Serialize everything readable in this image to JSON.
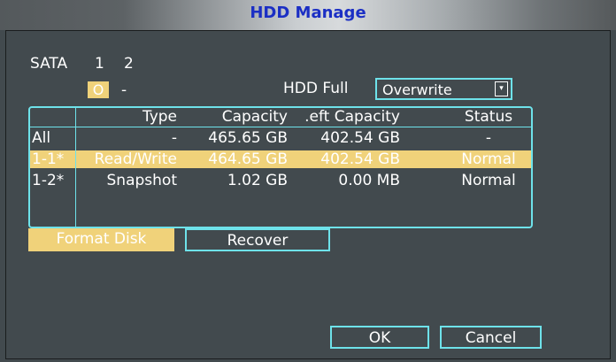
{
  "window": {
    "title": "HDD Manage"
  },
  "sata": {
    "label": "SATA",
    "ports": [
      "1",
      "2"
    ],
    "states": [
      "O",
      "-"
    ]
  },
  "hdd_full": {
    "label": "HDD Full",
    "value": "Overwrite",
    "arrow": "▾"
  },
  "table": {
    "headers": {
      "id": "",
      "type": "Type",
      "capacity": "Capacity",
      "left": ".eft Capacity",
      "status": "Status"
    },
    "rows": [
      {
        "id": "All",
        "type": "-",
        "capacity": "465.65 GB",
        "left": "402.54 GB",
        "status": "-"
      },
      {
        "id": "1-1*",
        "type": "Read/Write",
        "capacity": "464.65 GB",
        "left": "402.54 GB",
        "status": "Normal"
      },
      {
        "id": "1-2*",
        "type": "Snapshot",
        "capacity": "1.02 GB",
        "left": "0.00 MB",
        "status": "Normal"
      }
    ]
  },
  "buttons": {
    "format": "Format Disk",
    "recover": "Recover",
    "ok": "OK",
    "cancel": "Cancel"
  },
  "colors": {
    "background": "#424a4e",
    "accent": "#6ee2ea",
    "highlight": "#f0d27a",
    "title": "#1b2fc4"
  }
}
